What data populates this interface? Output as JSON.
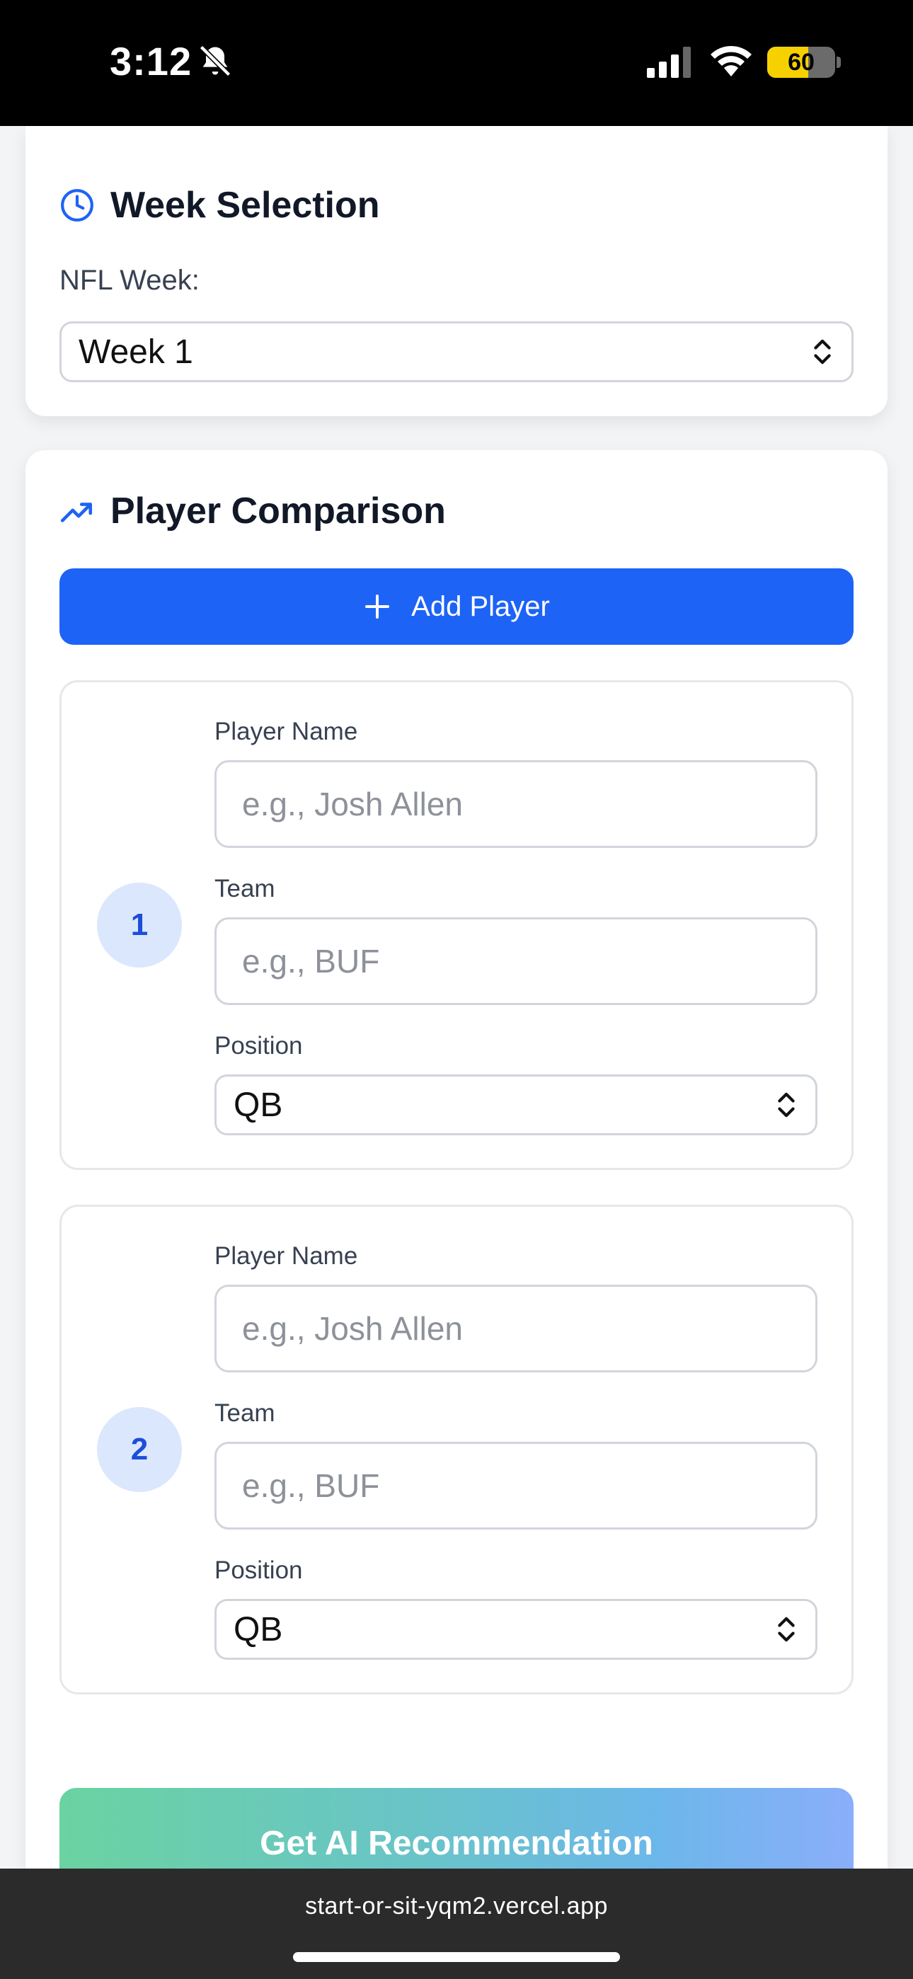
{
  "status_bar": {
    "time": "3:12",
    "battery_level": "60"
  },
  "week_selection": {
    "title": "Week Selection",
    "field_label": "NFL Week:",
    "selected_week": "Week 1"
  },
  "player_comparison": {
    "title": "Player Comparison",
    "add_button_label": "Add Player",
    "players": [
      {
        "number": "1",
        "name_label": "Player Name",
        "name_placeholder": "e.g., Josh Allen",
        "team_label": "Team",
        "team_placeholder": "e.g., BUF",
        "position_label": "Position",
        "position_value": "QB"
      },
      {
        "number": "2",
        "name_label": "Player Name",
        "name_placeholder": "e.g., Josh Allen",
        "team_label": "Team",
        "team_placeholder": "e.g., BUF",
        "position_label": "Position",
        "position_value": "QB"
      }
    ],
    "recommend_button_label": "Get AI Recommendation"
  },
  "browser": {
    "url": "start-or-sit-yqm2.vercel.app"
  },
  "colors": {
    "accent": "#1d63f5",
    "player_badge_bg": "#dbe7fd",
    "player_badge_text": "#1d4ed8"
  }
}
